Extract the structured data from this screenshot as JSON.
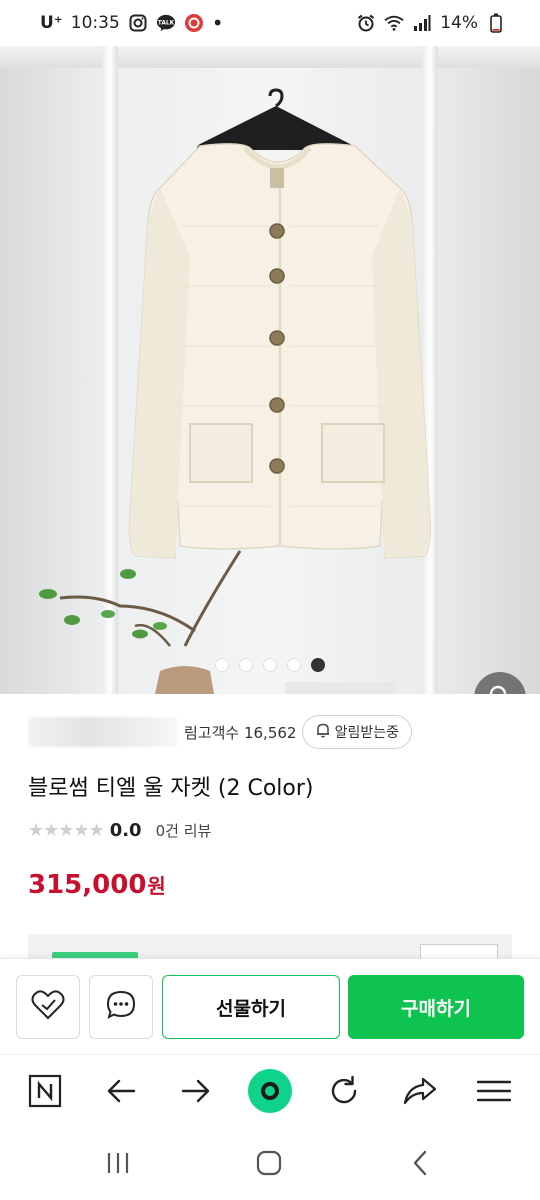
{
  "status_bar": {
    "carrier": "U⁺",
    "time": "10:35",
    "talk_label": "TALK",
    "battery": "14%"
  },
  "hero": {
    "image_count": 5,
    "active_index": 4
  },
  "store": {
    "visitors_label": "관심고객수 16,562",
    "visitors_visible": "림고객수 16,562",
    "alert_label": "알림받는중"
  },
  "product": {
    "title": "블로썸 티엘 울 자켓 (2 Color)",
    "rating": "0.0",
    "review_count": "0건 리뷰",
    "stars": 0,
    "price": "315,000",
    "price_unit": "원"
  },
  "actions": {
    "gift_label": "선물하기",
    "buy_label": "구매하기"
  },
  "colors": {
    "accent_green": "#0ec34f",
    "price_red": "#c8102e"
  },
  "icons": {
    "wishlist": "heart-check-icon",
    "chat": "chat-bubble-icon",
    "zoom": "search-icon",
    "naver": "naver-n-icon",
    "back": "arrow-left-icon",
    "forward": "arrow-right-icon",
    "home": "green-circle-icon",
    "refresh": "refresh-icon",
    "share": "share-icon",
    "menu": "hamburger-icon"
  }
}
